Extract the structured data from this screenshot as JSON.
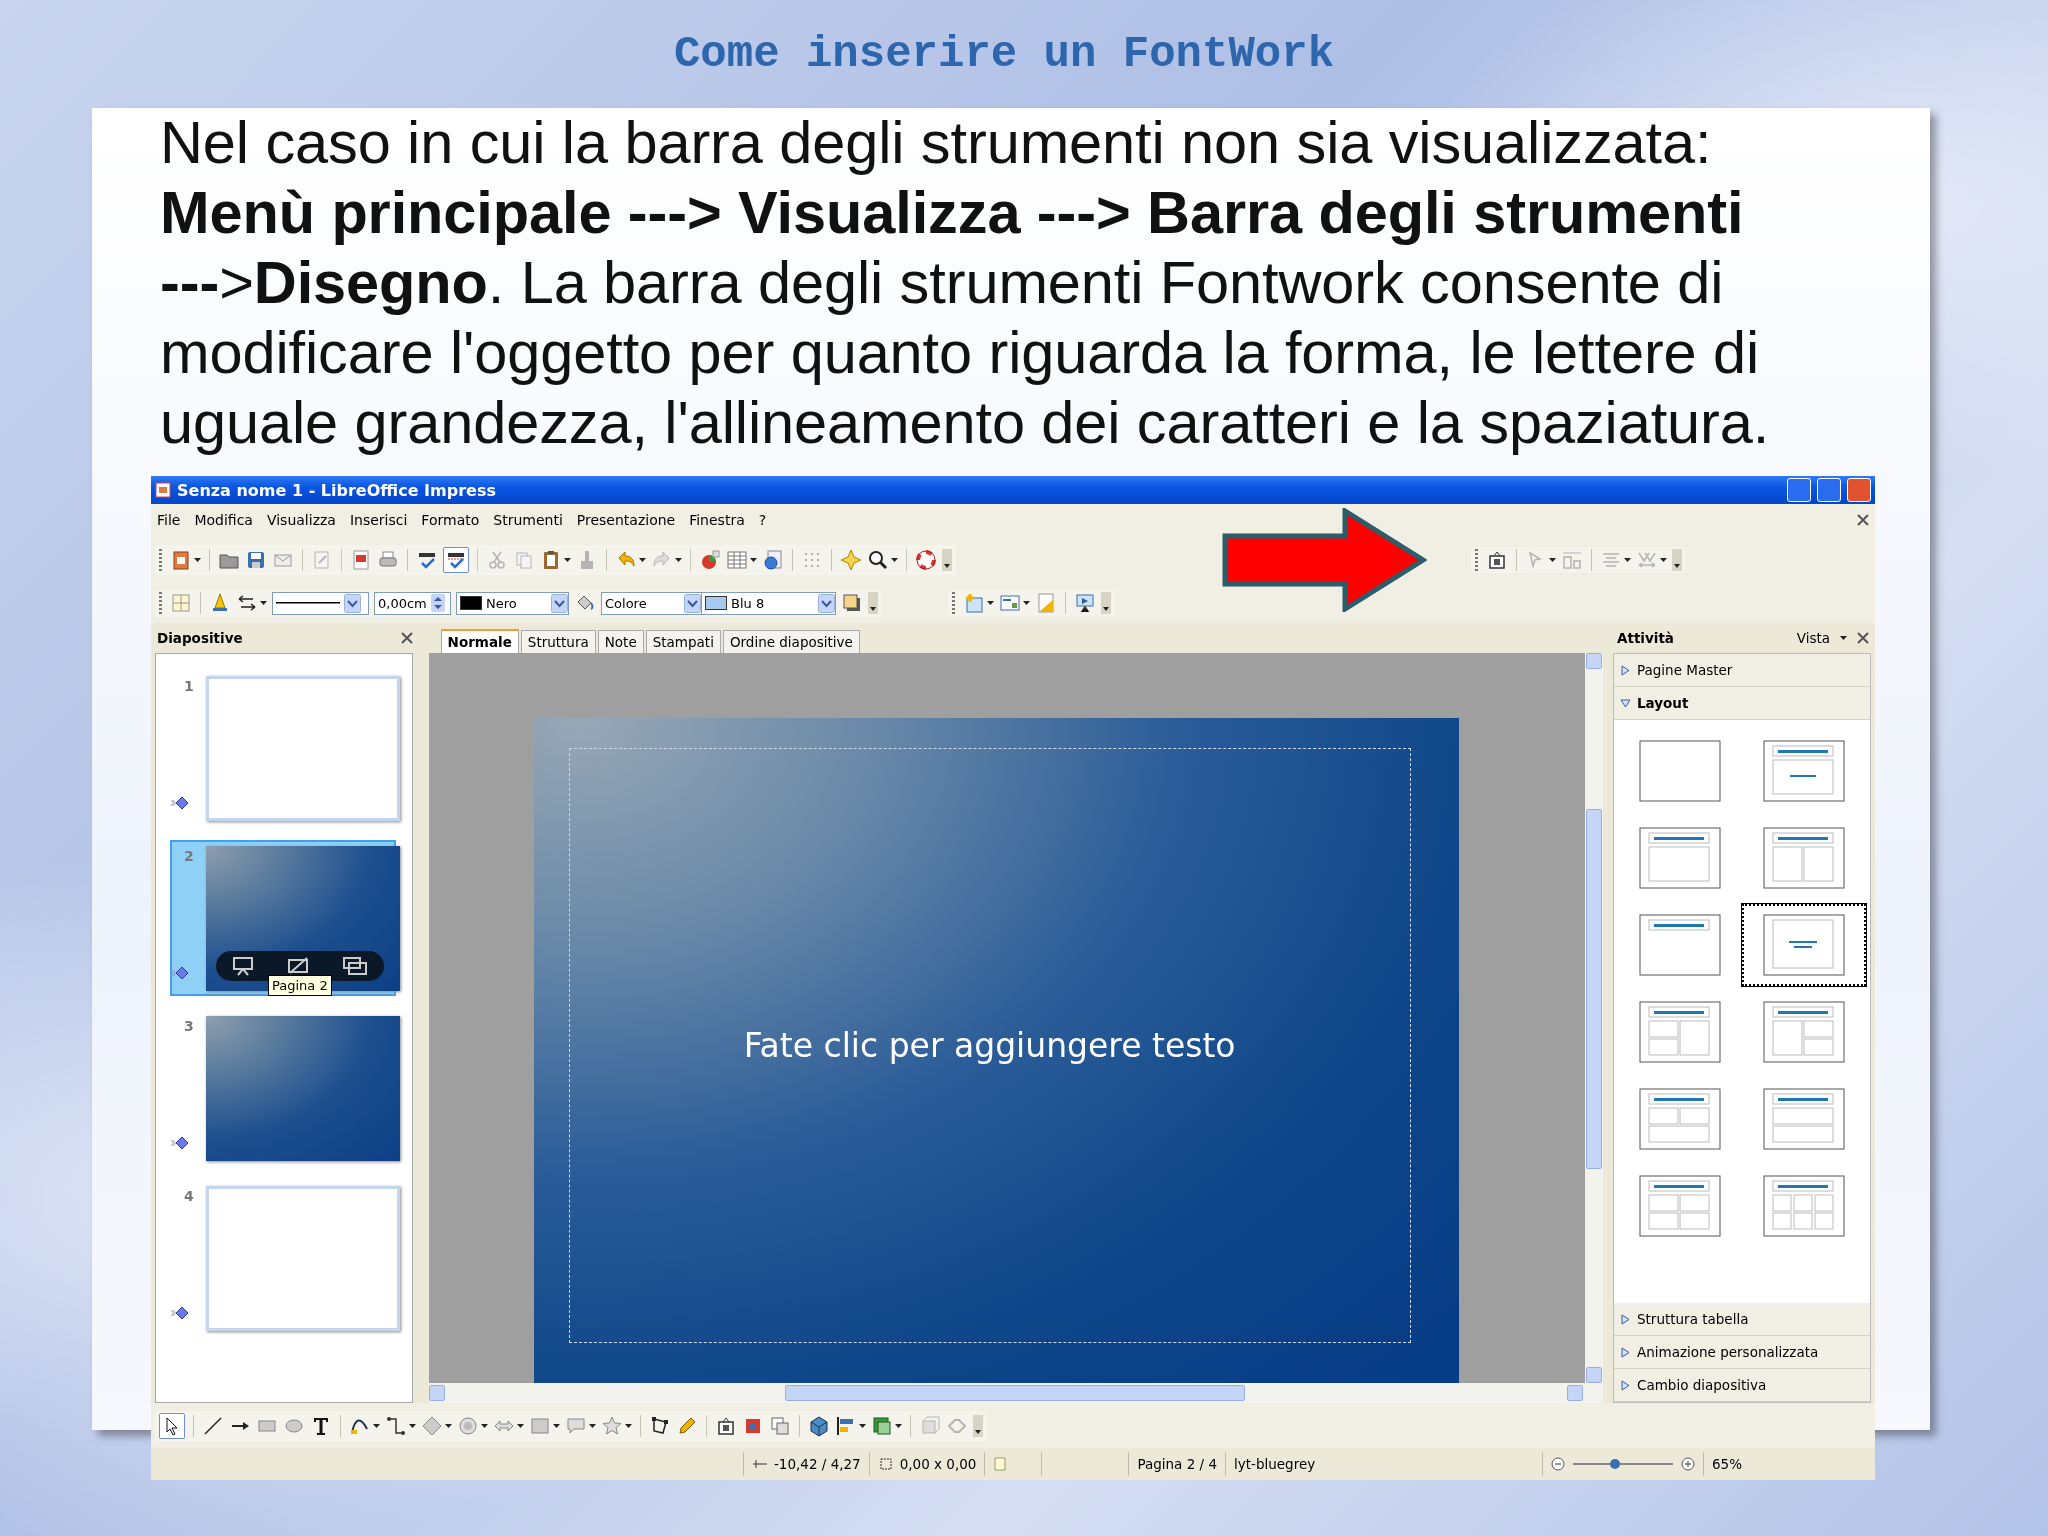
{
  "slide": {
    "title": "Come inserire un FontWork",
    "paragraph": "Nel caso in cui la barra degli strumenti non sia visualizzata: **Menù principale ---> Visualizza ---> Barra degli strumenti ---**>**Disegno**. La barra degli strumenti Fontwork consente di modificare l'oggetto per quanto riguarda la forma, le lettere di uguale grandezza, l'allineamento dei caratteri e la spaziatura."
  },
  "window": {
    "title": "Senza nome 1 - LibreOffice Impress",
    "menu": [
      "File",
      "Modifica",
      "Visualizza",
      "Inserisci",
      "Formato",
      "Strumenti",
      "Presentazione",
      "Finestra",
      "?"
    ],
    "line_and_fill": {
      "line_width": "0,00cm",
      "line_color": "Nero",
      "area_style": "Colore",
      "area_color": "Blu 8"
    },
    "slides_panel": {
      "title": "Diapositive",
      "tooltip": "Pagina 2",
      "slides": [
        {
          "number": "1",
          "kind": "white",
          "selected": false
        },
        {
          "number": "2",
          "kind": "blue",
          "selected": true
        },
        {
          "number": "3",
          "kind": "blue",
          "selected": false
        },
        {
          "number": "4",
          "kind": "white",
          "selected": false
        }
      ]
    },
    "view_tabs": [
      {
        "label": "Normale",
        "selected": true
      },
      {
        "label": "Struttura",
        "selected": false
      },
      {
        "label": "Note",
        "selected": false
      },
      {
        "label": "Stampati",
        "selected": false
      },
      {
        "label": "Ordine diapositive",
        "selected": false
      }
    ],
    "slide_placeholder": "Fate clic per aggiungere testo",
    "tasks_panel": {
      "title": "Attività",
      "view_menu": "Vista",
      "sections": [
        {
          "label": "Pagine Master",
          "expanded": false
        },
        {
          "label": "Layout",
          "expanded": true
        }
      ],
      "layouts": [
        {
          "kind": "blank",
          "selected": false
        },
        {
          "kind": "title-text",
          "selected": false
        },
        {
          "kind": "title-content",
          "selected": false
        },
        {
          "kind": "title-2cols",
          "selected": false
        },
        {
          "kind": "title-only",
          "selected": false
        },
        {
          "kind": "centered-text",
          "selected": true
        },
        {
          "kind": "title-2stack-1",
          "selected": false
        },
        {
          "kind": "title-1-2stack",
          "selected": false
        },
        {
          "kind": "title-2-over-1",
          "selected": false
        },
        {
          "kind": "title-1-over-1",
          "selected": false
        },
        {
          "kind": "title-4",
          "selected": false
        },
        {
          "kind": "title-6",
          "selected": false
        }
      ],
      "more_sections": [
        {
          "label": "Struttura tabella",
          "expanded": false
        },
        {
          "label": "Animazione personalizzata",
          "expanded": false
        },
        {
          "label": "Cambio diapositiva",
          "expanded": false
        }
      ]
    },
    "status_bar": {
      "position": "-10,42 / 4,27",
      "size": "0,00 x 0,00",
      "page": "Pagina 2 / 4",
      "master": "lyt-bluegrey",
      "zoom": "65%",
      "zoom_slider": {
        "level": 0.42
      }
    }
  }
}
